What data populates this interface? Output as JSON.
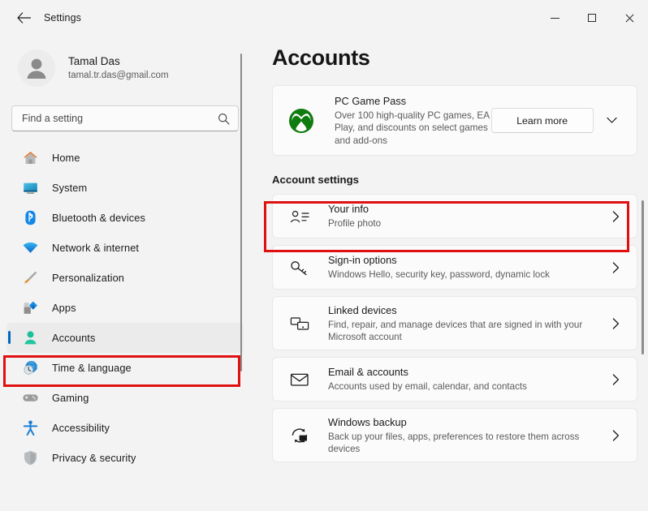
{
  "window": {
    "app_title": "Settings",
    "back_icon": "back-arrow-icon",
    "minimize_label": "Minimize",
    "maximize_label": "Maximize",
    "close_label": "Close"
  },
  "sidebar": {
    "profile": {
      "name": "Tamal Das",
      "email": "tamal.tr.das@gmail.com",
      "avatar_icon": "user-avatar-icon"
    },
    "search": {
      "placeholder": "Find a setting",
      "value": "",
      "icon": "search-icon"
    },
    "items": [
      {
        "label": "Home",
        "icon": "home-icon",
        "selected": false
      },
      {
        "label": "System",
        "icon": "system-monitor-icon",
        "selected": false
      },
      {
        "label": "Bluetooth & devices",
        "icon": "bluetooth-icon",
        "selected": false
      },
      {
        "label": "Network & internet",
        "icon": "wifi-icon",
        "selected": false
      },
      {
        "label": "Personalization",
        "icon": "paintbrush-icon",
        "selected": false
      },
      {
        "label": "Apps",
        "icon": "apps-icon",
        "selected": false
      },
      {
        "label": "Accounts",
        "icon": "accounts-person-icon",
        "selected": true
      },
      {
        "label": "Time & language",
        "icon": "clock-globe-icon",
        "selected": false
      },
      {
        "label": "Gaming",
        "icon": "gamepad-icon",
        "selected": false
      },
      {
        "label": "Accessibility",
        "icon": "accessibility-person-icon",
        "selected": false
      },
      {
        "label": "Privacy & security",
        "icon": "shield-icon",
        "selected": false
      }
    ]
  },
  "main": {
    "page_title": "Accounts",
    "gamepass": {
      "title": "PC Game Pass",
      "description": "Over 100 high-quality PC games, EA Play, and discounts on select games and add-ons",
      "button_label": "Learn more",
      "logo_icon": "xbox-logo-icon",
      "expand_icon": "chevron-down-icon"
    },
    "section_title": "Account settings",
    "rows": [
      {
        "title": "Your info",
        "subtitle": "Profile photo",
        "icon": "contact-card-icon",
        "highlighted": true
      },
      {
        "title": "Sign-in options",
        "subtitle": "Windows Hello, security key, password, dynamic lock",
        "icon": "key-icon",
        "highlighted": false
      },
      {
        "title": "Linked devices",
        "subtitle": "Find, repair, and manage devices that are signed in with your Microsoft account",
        "icon": "linked-devices-icon",
        "highlighted": false
      },
      {
        "title": "Email & accounts",
        "subtitle": "Accounts used by email, calendar, and contacts",
        "icon": "envelope-icon",
        "highlighted": false
      },
      {
        "title": "Windows backup",
        "subtitle": "Back up your files, apps, preferences to restore them across devices",
        "icon": "backup-sync-icon",
        "highlighted": false
      }
    ],
    "chevron_icon": "chevron-right-icon"
  },
  "colors": {
    "accent": "#0067c0",
    "annotation": "#e01010",
    "window_bg": "#f3f3f3",
    "card_bg": "#fbfbfb",
    "xbox_green": "#107c10"
  }
}
